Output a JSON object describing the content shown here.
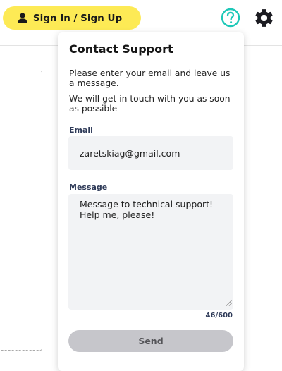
{
  "header": {
    "sign_in_label": "Sign In / Sign Up",
    "user_icon": "user-icon",
    "help_icon": "help-circle-icon",
    "settings_icon": "gear-icon"
  },
  "support_panel": {
    "title": "Contact Support",
    "intro_line1": "Please enter your email and leave us a message.",
    "intro_line2": "We will get in touch with you as soon as possible",
    "email_label": "Email",
    "email_value": "zaretskiag@gmail.com",
    "message_label": "Message",
    "message_value": "Message to technical support! Help me, please!",
    "char_counter": "46/600",
    "send_label": "Send"
  },
  "colors": {
    "sign_in_button": "#fdea55",
    "help_icon": "#1ec8b8",
    "send_button_disabled": "#c6c6cb",
    "field_background": "#f2f3f5"
  }
}
